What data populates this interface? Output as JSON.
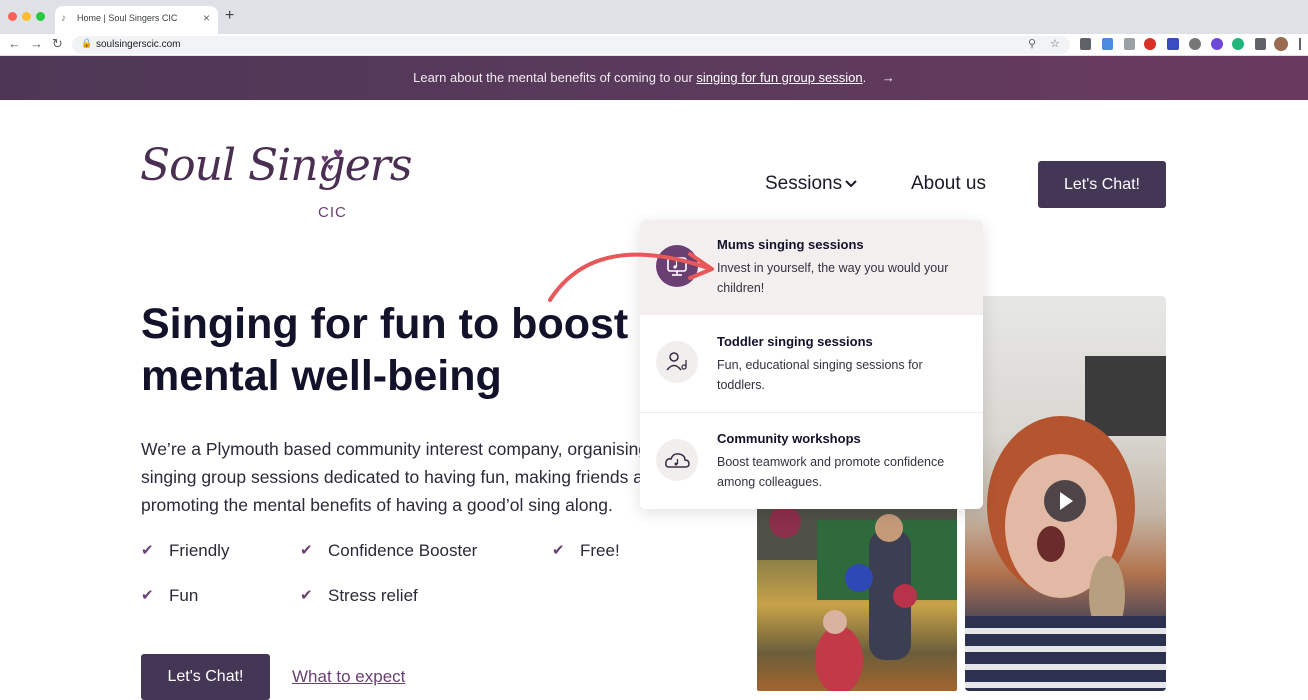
{
  "browser": {
    "tab_title": "Home | Soul Singers CIC",
    "new_tab": "+",
    "url": "soulsingerscic.com",
    "back": "←",
    "forward": "→",
    "reload": "↻",
    "traffic_colors": [
      "#ff5f57",
      "#febc2e",
      "#28c840"
    ]
  },
  "announcement": {
    "text_before": "Learn about the mental benefits of coming to our ",
    "link": "singing for fun group session",
    "text_after": ".",
    "arrow": "→"
  },
  "logo": {
    "name": "Soul Singers",
    "suffix": "CIC"
  },
  "nav": {
    "sessions_label": "Sessions",
    "about_label": "About us",
    "cta_label": "Let's Chat!"
  },
  "dropdown": {
    "items": [
      {
        "title": "Mums singing sessions",
        "description": "Invest in yourself, the way you would your children!",
        "icon": "monitor-music-icon",
        "active": true
      },
      {
        "title": "Toddler singing sessions",
        "description": "Fun, educational singing sessions for toddlers.",
        "icon": "child-music-icon",
        "active": false
      },
      {
        "title": "Community workshops",
        "description": "Boost teamwork and promote confidence among colleagues.",
        "icon": "cloud-music-icon",
        "active": false
      }
    ]
  },
  "hero": {
    "title": "Singing for fun to boost mental well-being",
    "copy_line1": "We’re a Plymouth based community interest company, organising",
    "copy_line2": "singing group sessions dedicated to having fun, making friends and",
    "copy_line3": "promoting the mental benefits of having a good’ol sing along.",
    "features": [
      "Friendly",
      "Confidence Booster",
      "Free!",
      "Fun",
      "Stress relief"
    ],
    "cta_label": "Let's Chat!",
    "secondary_link": "What to expect"
  },
  "colors": {
    "brand": "#443756",
    "accent": "#6a3f72",
    "annotation_arrow": "#e8585a"
  }
}
